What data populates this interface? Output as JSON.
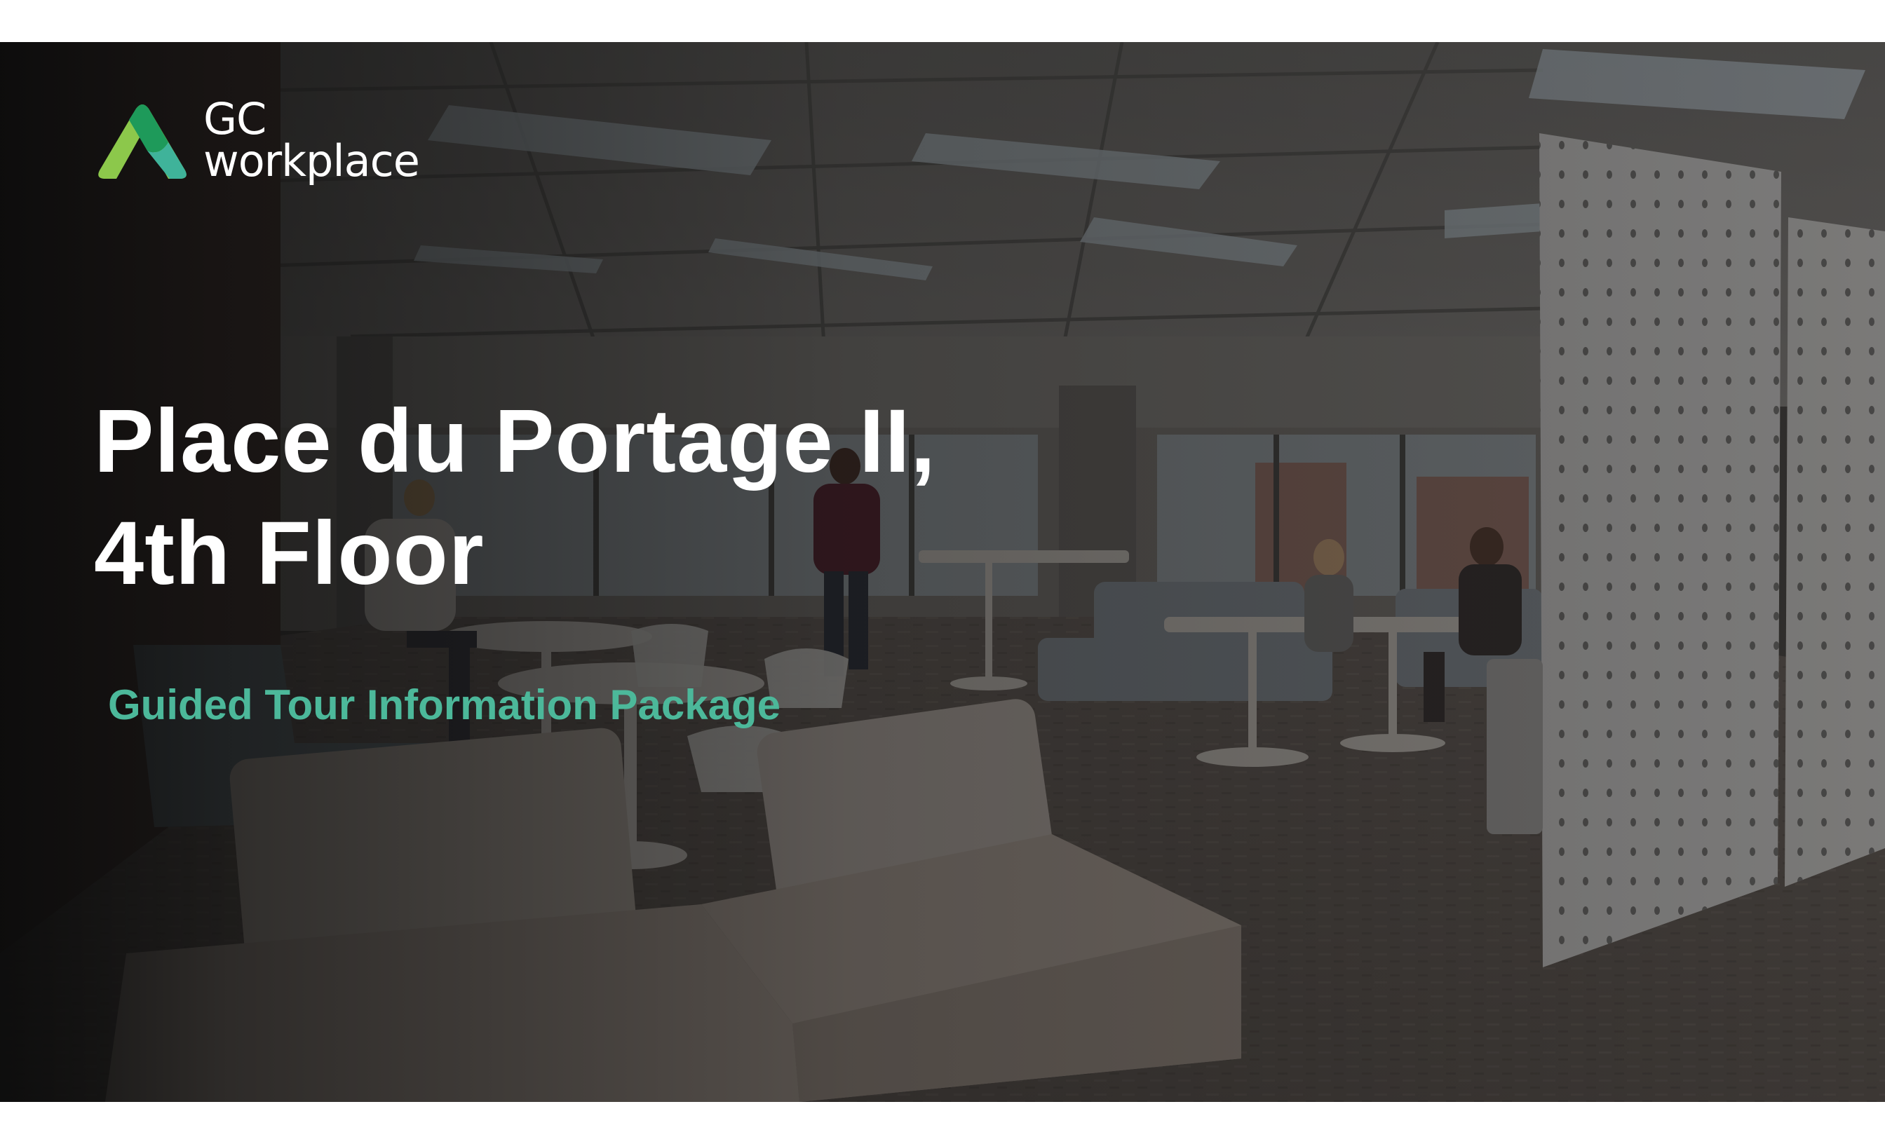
{
  "logo": {
    "line1": "GC",
    "line2": "workplace",
    "colors": {
      "dark_green": "#1e9a5a",
      "light_green": "#8cc84b",
      "teal": "#3fb39a"
    }
  },
  "title": {
    "line1": "Place du Portage II,",
    "line2": "4th Floor"
  },
  "subtitle": "Guided Tour Information Package",
  "colors": {
    "subtitle": "#4cb89a",
    "title": "#ffffff",
    "overlay_left": "#0b0b0b"
  }
}
